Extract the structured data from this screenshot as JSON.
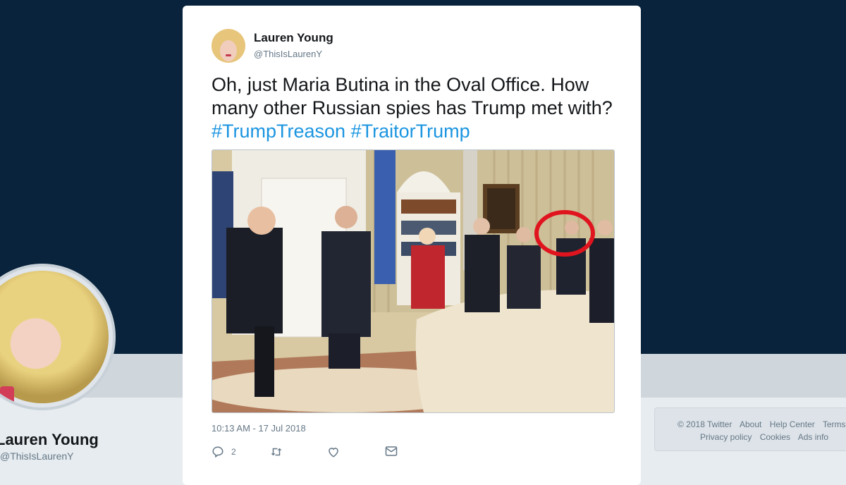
{
  "profile": {
    "name": "Lauren Young",
    "handle_partial": "@ThisIsLaurenY"
  },
  "tweet": {
    "author_name": "Lauren Young",
    "author_handle": "@ThisIsLaurenY",
    "text": "Oh, just Maria Butina in the Oval Office. How many other Russian spies has Trump met with?",
    "hashtags": [
      "#TrumpTreason",
      "#TraitorTrump"
    ],
    "timestamp": "10:13 AM - 17 Jul 2018",
    "reply_count": "2",
    "retweet_count": "",
    "like_count": "",
    "media_description": "photo"
  },
  "footer": {
    "row1": [
      "© 2018 Twitter",
      "About",
      "Help Center",
      "Terms"
    ],
    "row2": [
      "Privacy policy",
      "Cookies",
      "Ads info"
    ]
  },
  "icons": {
    "reply": "reply-icon",
    "retweet": "retweet-icon",
    "like": "heart-icon",
    "message": "envelope-icon"
  },
  "colors": {
    "header_bg": "#08233b",
    "hashtag": "#1b95e0",
    "annotation_circle": "#e0141e"
  }
}
